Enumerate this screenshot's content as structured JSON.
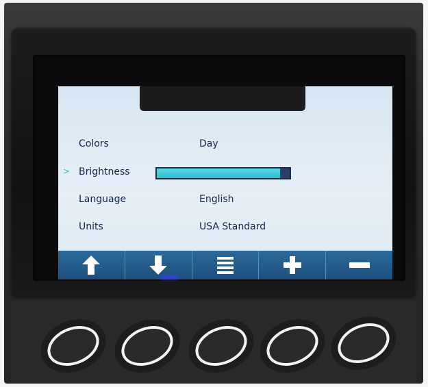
{
  "settings": {
    "rows": [
      {
        "label": "Colors",
        "value": "Day"
      },
      {
        "label": "Brightness",
        "level_percent": 93,
        "selected_marker": ">"
      },
      {
        "label": "Language",
        "value": "English"
      },
      {
        "label": "Units",
        "value": "USA Standard"
      }
    ]
  },
  "toolbar": {
    "buttons": [
      {
        "name": "up-button",
        "icon": "arrow-up-icon"
      },
      {
        "name": "down-button",
        "icon": "arrow-down-icon"
      },
      {
        "name": "menu-button",
        "icon": "menu-icon"
      },
      {
        "name": "plus-button",
        "icon": "plus-icon"
      },
      {
        "name": "minus-button",
        "icon": "minus-icon"
      }
    ]
  },
  "colors": {
    "screen_bg": "#e0ebf4",
    "text": "#12264a",
    "brightness_fill": "#2fbccc",
    "toolbar_bg": "#1d4f7c",
    "icon": "#ffffff"
  }
}
